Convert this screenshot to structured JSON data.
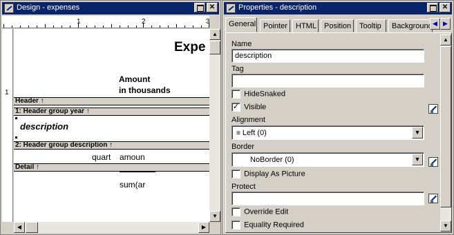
{
  "design_window": {
    "title": "Design - expenses",
    "ruler_marks": [
      "1",
      "2",
      "3"
    ],
    "vruler_mark": "1",
    "canvas": {
      "report_title": "Expe",
      "amount_line1": "Amount",
      "amount_line2": "in thousands",
      "bands": {
        "header": "Header ↑",
        "group1": "1: Header group year ↑",
        "group2": "2: Header group description ↑",
        "detail": "Detail ↑"
      },
      "description_field": "description",
      "quart_field": "quart",
      "amount_field": "amoun",
      "sum_field": "sum(ar"
    }
  },
  "properties_window": {
    "title": "Properties - description",
    "tabs": [
      "General",
      "Pointer",
      "HTML",
      "Position",
      "Tooltip",
      "Background"
    ],
    "active_tab": "General",
    "fields": {
      "name_label": "Name",
      "name_value": "description",
      "tag_label": "Tag",
      "tag_value": "",
      "hidesnaked_label": "HideSnaked",
      "hidesnaked_checked": false,
      "visible_label": "Visible",
      "visible_checked": true,
      "alignment_label": "Alignment",
      "alignment_value": "Left (0)",
      "border_label": "Border",
      "border_value": "NoBorder (0)",
      "display_as_picture_label": "Display As Picture",
      "display_as_picture_checked": false,
      "protect_label": "Protect",
      "protect_value": "",
      "override_edit_label": "Override Edit",
      "override_edit_checked": false,
      "equality_required_label": "Equality Required",
      "equality_required_checked": false
    }
  },
  "colors": {
    "title_bar": "#0a246a",
    "face": "#d4d0c8"
  }
}
